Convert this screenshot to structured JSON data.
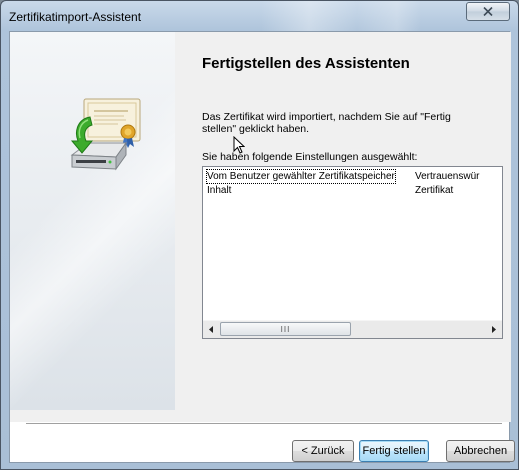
{
  "window": {
    "title": "Zertifikatimport-Assistent"
  },
  "main": {
    "heading": "Fertigstellen des Assistenten",
    "description": "Das Zertifikat wird importiert, nachdem Sie auf \"Fertig stellen\" geklickt haben.",
    "settings_label": "Sie haben folgende Einstellungen ausgewählt:",
    "settings": [
      {
        "name": "Vom Benutzer gewählter Zertifikatspeicher",
        "value": "Vertrauenswür"
      },
      {
        "name": "Inhalt",
        "value": "Zertifikat"
      }
    ],
    "scroll_grip": "III"
  },
  "buttons": {
    "back": "< Zurück",
    "finish": "Fertig stellen",
    "cancel": "Abbrechen"
  }
}
